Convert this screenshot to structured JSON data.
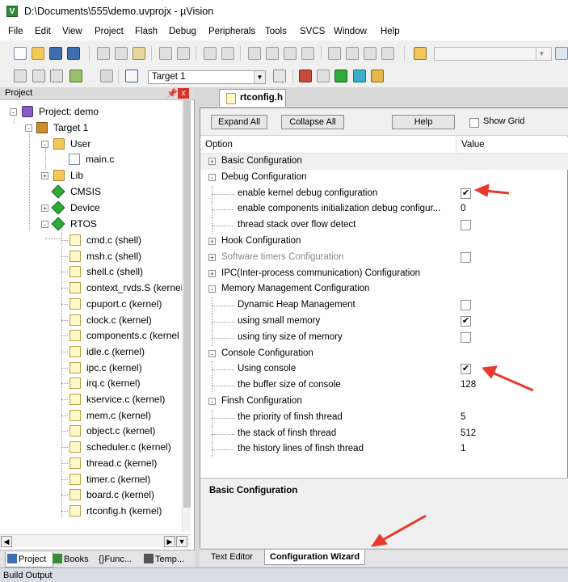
{
  "window": {
    "title": "D:\\Documents\\555\\demo.uvprojx - µVision",
    "app_icon": "uvision-icon"
  },
  "menu": [
    "File",
    "Edit",
    "View",
    "Project",
    "Flash",
    "Debug",
    "Peripherals",
    "Tools",
    "SVCS",
    "Window",
    "Help"
  ],
  "toolbar2": {
    "target": "Target 1"
  },
  "project_pane": {
    "title": "Project",
    "pin": "ᵖ",
    "close": "x",
    "root": "Project: demo",
    "target": "Target 1",
    "groups": {
      "user": "User",
      "lib": "Lib",
      "cmsis": "CMSIS",
      "device": "Device",
      "rtos": "RTOS"
    },
    "user_files": [
      "main.c"
    ],
    "rtos_files": [
      "cmd.c (shell)",
      "msh.c (shell)",
      "shell.c (shell)",
      "context_rvds.S (kernel",
      "cpuport.c (kernel)",
      "clock.c (kernel)",
      "components.c (kernel",
      "idle.c (kernel)",
      "ipc.c (kernel)",
      "irq.c (kernel)",
      "kservice.c (kernel)",
      "mem.c (kernel)",
      "object.c (kernel)",
      "scheduler.c (kernel)",
      "thread.c (kernel)",
      "timer.c (kernel)",
      "board.c (kernel)",
      "rtconfig.h (kernel)"
    ],
    "tabs": [
      "Project",
      "Books",
      "Func...",
      "Temp..."
    ],
    "tab_prefixes": [
      "",
      "",
      "{}",
      ""
    ]
  },
  "editor": {
    "tab": "rtconfig.h",
    "buttons": {
      "expand": "Expand All",
      "collapse": "Collapse All",
      "help": "Help"
    },
    "show_grid": "Show Grid",
    "columns": {
      "option": "Option",
      "value": "Value"
    },
    "rows": [
      {
        "label": "Basic Configuration",
        "level": 0,
        "exp": "+",
        "value": "",
        "type": "none",
        "selected": true
      },
      {
        "label": "Debug Configuration",
        "level": 0,
        "exp": "-",
        "value": "",
        "type": "none"
      },
      {
        "label": "enable kernel debug configuration",
        "level": 1,
        "value": "✔",
        "type": "check"
      },
      {
        "label": "enable components initialization debug configur...",
        "level": 1,
        "value": "0",
        "type": "text"
      },
      {
        "label": "thread stack over flow detect",
        "level": 1,
        "value": "",
        "type": "check"
      },
      {
        "label": "Hook Configuration",
        "level": 0,
        "exp": "+",
        "value": "",
        "type": "none"
      },
      {
        "label": "Software timers Configuration",
        "level": 0,
        "exp": "+",
        "value": "",
        "type": "check",
        "dim": true
      },
      {
        "label": "IPC(Inter-process communication) Configuration",
        "level": 0,
        "exp": "+",
        "value": "",
        "type": "none"
      },
      {
        "label": "Memory Management Configuration",
        "level": 0,
        "exp": "-",
        "value": "",
        "type": "none"
      },
      {
        "label": "Dynamic Heap Management",
        "level": 1,
        "value": "",
        "type": "check"
      },
      {
        "label": "using small memory",
        "level": 1,
        "value": "✔",
        "type": "check"
      },
      {
        "label": "using tiny size of memory",
        "level": 1,
        "value": "",
        "type": "check"
      },
      {
        "label": "Console Configuration",
        "level": 0,
        "exp": "-",
        "value": "",
        "type": "none"
      },
      {
        "label": "Using console",
        "level": 1,
        "value": "✔",
        "type": "check"
      },
      {
        "label": "the buffer size of console",
        "level": 1,
        "value": "128",
        "type": "text"
      },
      {
        "label": "Finsh Configuration",
        "level": 0,
        "exp": "-",
        "value": "",
        "type": "none"
      },
      {
        "label": "the priority of finsh thread",
        "level": 1,
        "value": "5",
        "type": "text"
      },
      {
        "label": "the stack of finsh thread",
        "level": 1,
        "value": "512",
        "type": "text"
      },
      {
        "label": "the history lines of finsh thread",
        "level": 1,
        "value": "1",
        "type": "text"
      }
    ],
    "description_title": "Basic Configuration",
    "bottom_tabs": {
      "text_editor": "Text Editor",
      "config_wizard": "Configuration Wizard"
    }
  },
  "status": {
    "build_output": "Build Output"
  },
  "colors": {
    "arrow": "#e8392c",
    "accent": "#2e8b3a"
  }
}
